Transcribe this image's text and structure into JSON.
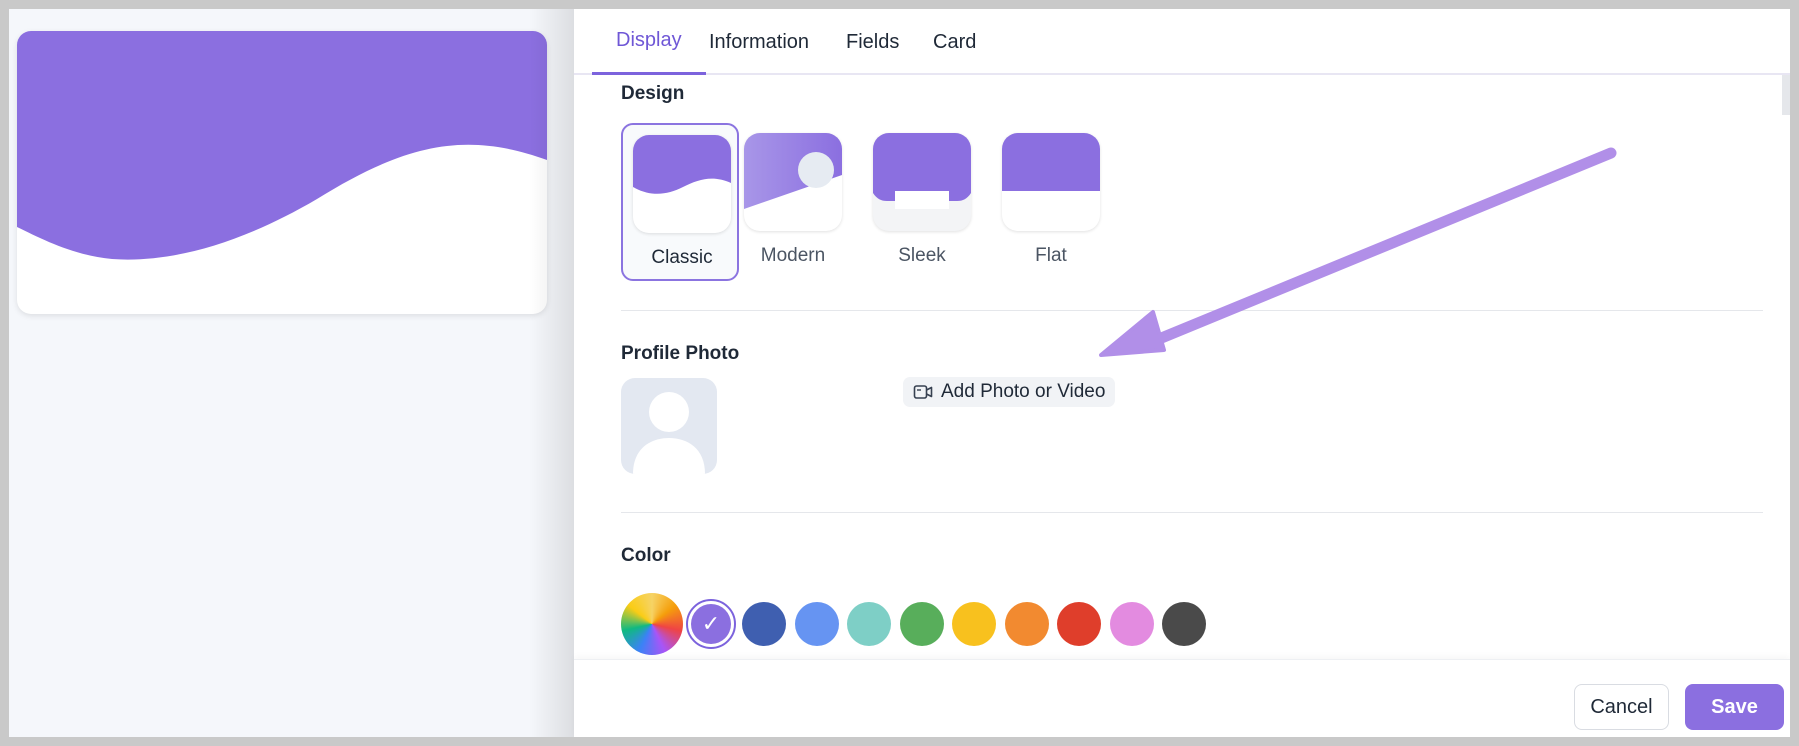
{
  "tabs": [
    {
      "label": "Display",
      "active": true
    },
    {
      "label": "Information",
      "active": false
    },
    {
      "label": "Fields",
      "active": false
    },
    {
      "label": "Card",
      "active": false
    }
  ],
  "design": {
    "title": "Design",
    "options": [
      {
        "label": "Classic",
        "selected": true
      },
      {
        "label": "Modern",
        "selected": false
      },
      {
        "label": "Sleek",
        "selected": false
      },
      {
        "label": "Flat",
        "selected": false
      }
    ]
  },
  "profile_photo": {
    "title": "Profile Photo",
    "add_label": "Add Photo or Video"
  },
  "color": {
    "title": "Color",
    "swatches": [
      "rainbow",
      "#8b6fe0",
      "#3f5fb0",
      "#6694f2",
      "#7ecfc6",
      "#58ae5b",
      "#f8c11e",
      "#f28a30",
      "#df3e2b",
      "#e38be0",
      "#4a4a4a"
    ],
    "selected_index": 1
  },
  "footer": {
    "cancel_label": "Cancel",
    "save_label": "Save"
  },
  "colors": {
    "accent": "#8b6fe0",
    "annotation_arrow": "#b18fe8"
  },
  "icons": {
    "add_photo": "video-icon",
    "check": "check-icon"
  }
}
